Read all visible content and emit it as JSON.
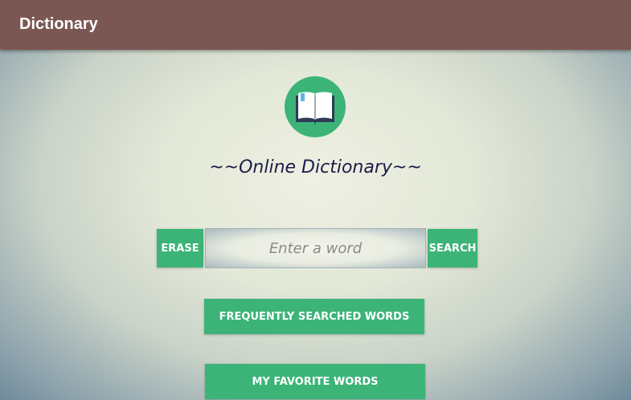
{
  "toolbar": {
    "title": "Dictionary"
  },
  "logo": {
    "icon": "open-book-icon",
    "background": "#3cb478"
  },
  "main": {
    "heading": "~~Online Dictionary~~"
  },
  "search": {
    "erase_label": "ERASE",
    "placeholder": "Enter a word",
    "value": "",
    "search_label": "SEARCH"
  },
  "buttons": {
    "frequent_label": "FREQUENTLY SEARCHED WORDS",
    "favorites_label": "MY FAVORITE WORDS"
  },
  "colors": {
    "toolbar": "#7b5754",
    "accent": "#3cb478",
    "heading_text": "#1d1b4a"
  }
}
